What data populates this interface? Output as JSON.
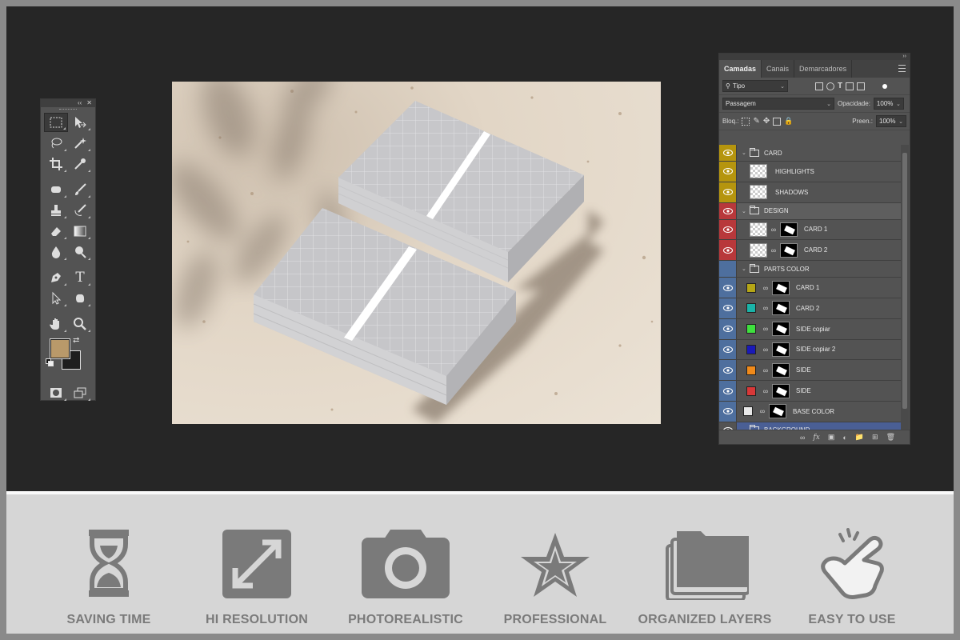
{
  "tools": {
    "collapse_glyph": "‹‹",
    "close_glyph": "✕",
    "icons": [
      "rectangular-marquee",
      "move",
      "lasso",
      "magic-wand",
      "crop",
      "eyedropper",
      "spot-healing",
      "brush",
      "clone-stamp",
      "history-brush",
      "eraser",
      "gradient",
      "blur",
      "dodge",
      "pen",
      "type",
      "path-selection",
      "custom-shape",
      "hand",
      "zoom",
      "quick-mask",
      "screen-mode"
    ],
    "type_glyph": "T",
    "swap_glyph": "⇄",
    "foreground_color": "#b9996a",
    "background_color": "#1e1e1e"
  },
  "layers_panel": {
    "expand_glyph": "››",
    "tabs": [
      "Camadas",
      "Canais",
      "Demarcadores"
    ],
    "filter_label": "Tipo",
    "blend_mode": "Passagem",
    "opacity_label": "Opacidade:",
    "opacity_value": "100%",
    "lock_label": "Bloq.:",
    "fill_label": "Preen.:",
    "fill_value": "100%",
    "layers": [
      {
        "name": "CARD",
        "kind": "folder",
        "label_color": "#b5950e"
      },
      {
        "name": "HIGHLIGHTS",
        "kind": "layer",
        "label_color": "#b5950e"
      },
      {
        "name": "SHADOWS",
        "kind": "layer",
        "label_color": "#b5950e"
      },
      {
        "name": "DESIGN",
        "kind": "folder",
        "label_color": "#b8383b"
      },
      {
        "name": "CARD 1",
        "kind": "smart",
        "label_color": "#b8383b"
      },
      {
        "name": "CARD 2",
        "kind": "smart",
        "label_color": "#b8383b"
      },
      {
        "name": "PARTS COLOR",
        "kind": "folder",
        "label_color": "#4e6f9e"
      },
      {
        "name": "CARD 1",
        "kind": "fill",
        "swatch": "#b5a616",
        "label_color": "#4e6f9e"
      },
      {
        "name": "CARD 2",
        "kind": "fill",
        "swatch": "#1ab3a8",
        "label_color": "#4e6f9e"
      },
      {
        "name": "SIDE copiar",
        "kind": "fill",
        "swatch": "#3ee03e",
        "label_color": "#4e6f9e"
      },
      {
        "name": "SIDE copiar 2",
        "kind": "fill",
        "swatch": "#1a1ab8",
        "label_color": "#4e6f9e"
      },
      {
        "name": "SIDE",
        "kind": "fill",
        "swatch": "#f08a1a",
        "label_color": "#4e6f9e"
      },
      {
        "name": "SIDE",
        "kind": "fill",
        "swatch": "#d83838",
        "label_color": "#4e6f9e"
      },
      {
        "name": "BASE COLOR",
        "kind": "base",
        "swatch": "#e8e8e8",
        "label_color": "#4e6f9e"
      },
      {
        "name": "BACKGROUND",
        "kind": "folder",
        "label_color": "#535353"
      }
    ],
    "footer_icons": [
      "link-icon",
      "fx-icon",
      "mask-icon",
      "adjustment-icon",
      "group-icon",
      "new-layer-icon",
      "trash-icon"
    ]
  },
  "features": [
    {
      "label": "SAVING TIME",
      "icon": "hourglass-icon"
    },
    {
      "label": "HI RESOLUTION",
      "icon": "expand-icon"
    },
    {
      "label": "PHOTOREALISTIC",
      "icon": "camera-icon"
    },
    {
      "label": "PROFESSIONAL",
      "icon": "star-icon"
    },
    {
      "label": "ORGANIZED LAYERS",
      "icon": "layers-folder-icon"
    },
    {
      "label": "EASY TO USE",
      "icon": "pointing-hand-icon"
    }
  ],
  "colors": {
    "workspace": "#262626",
    "feature_bar": "#d6d6d6",
    "feature_icon": "#7a7a7a",
    "selected_layer": "#4a5f95"
  }
}
